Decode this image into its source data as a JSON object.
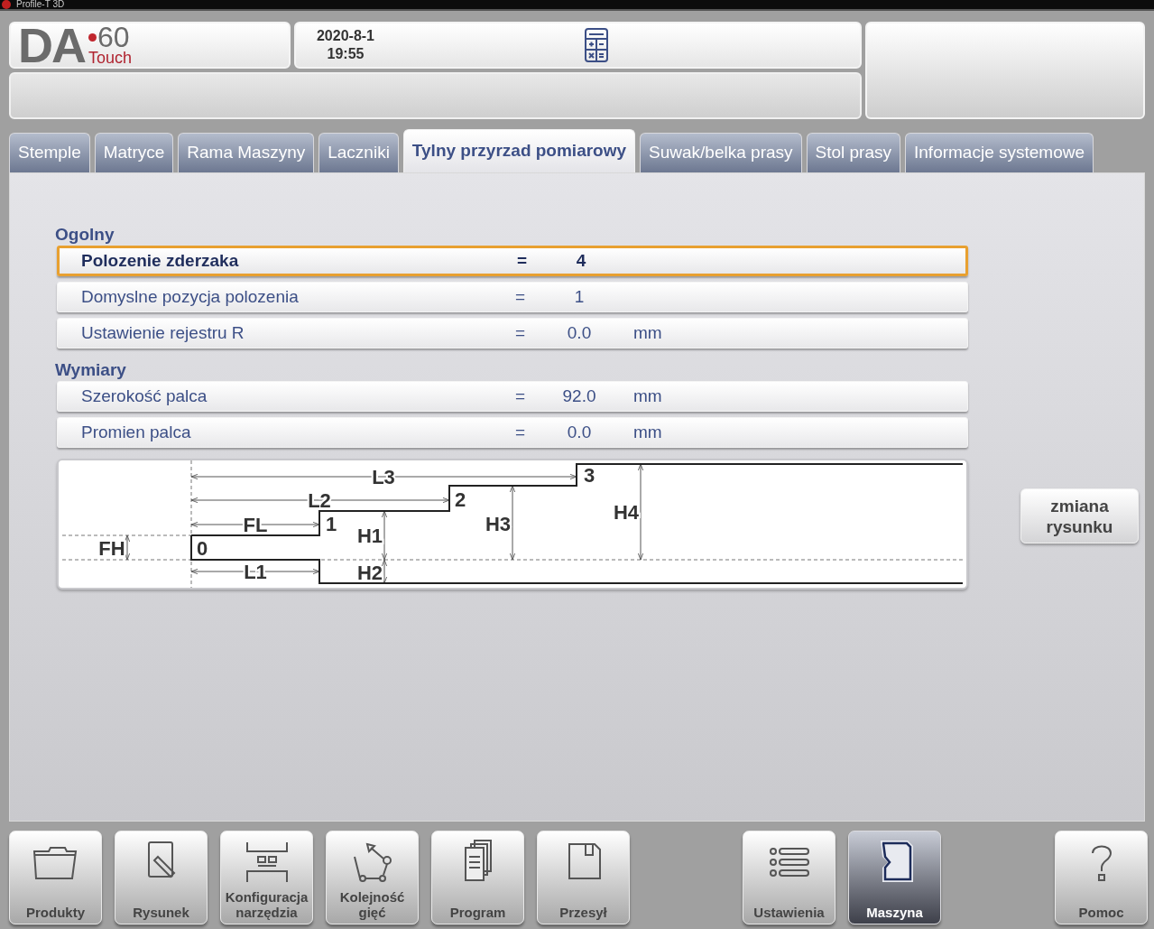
{
  "window": {
    "title": "Profile-T 3D"
  },
  "header": {
    "logo": {
      "letters": "DA",
      "model": "60",
      "edition": "Touch"
    },
    "date": "2020-8-1",
    "time": "19:55"
  },
  "tabs": [
    {
      "label": "Stemple",
      "selected": false
    },
    {
      "label": "Matryce",
      "selected": false
    },
    {
      "label": "Rama Maszyny",
      "selected": false
    },
    {
      "label": "Laczniki",
      "selected": false
    },
    {
      "label": "Tylny przyrzad pomiarowy",
      "selected": true
    },
    {
      "label": "Suwak/belka prasy",
      "selected": false
    },
    {
      "label": "Stol prasy",
      "selected": false
    },
    {
      "label": "Informacje systemowe",
      "selected": false
    }
  ],
  "sections": [
    {
      "title": "Ogolny",
      "rows": [
        {
          "label": "Polozenie zderzaka",
          "operator": "=",
          "value": "4",
          "selected": true
        },
        {
          "label": "Domyslne pozycja polozenia",
          "operator": "=",
          "value": "1",
          "selected": false
        },
        {
          "label": "Ustawienie rejestru R",
          "operator": "=",
          "value": "0.0",
          "unit": "mm",
          "selected": false
        }
      ]
    },
    {
      "title": "Wymiary",
      "rows": [
        {
          "label": "Szerokość palca",
          "operator": "=",
          "value": "92.0",
          "unit": "mm",
          "selected": false
        },
        {
          "label": "Promien palca",
          "operator": "=",
          "value": "0.0",
          "unit": "mm",
          "selected": false
        }
      ]
    }
  ],
  "diagram": {
    "labels": [
      "L3",
      "L2",
      "FL",
      "L1",
      "FH",
      "H1",
      "H2",
      "H3",
      "H4",
      "0",
      "1",
      "2",
      "3"
    ]
  },
  "change_drawing_button": "zmiana rysunku",
  "toolbar": {
    "left": [
      {
        "label": "Produkty",
        "selected": false
      },
      {
        "label": "Rysunek",
        "selected": false
      },
      {
        "label": "Konfiguracja narzędzia",
        "selected": false
      },
      {
        "label": "Kolejność gięć",
        "selected": false
      },
      {
        "label": "Program",
        "selected": false
      },
      {
        "label": "Przesył",
        "selected": false
      }
    ],
    "middle": [
      {
        "label": "Ustawienia",
        "selected": false
      },
      {
        "label": "Maszyna",
        "selected": true
      }
    ],
    "right": [
      {
        "label": "Pomoc",
        "selected": false
      }
    ]
  }
}
